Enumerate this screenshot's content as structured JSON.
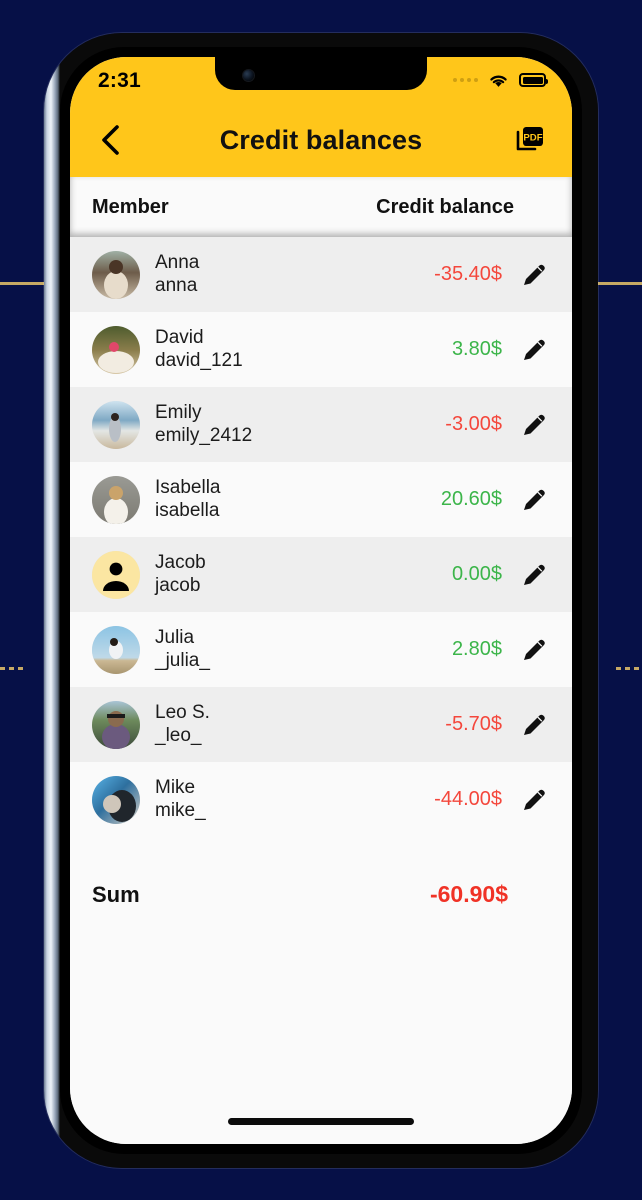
{
  "background": {
    "color": "#061047"
  },
  "status_bar": {
    "time": "2:31",
    "signal_icon": "cellular-dots-icon",
    "wifi_icon": "wifi-icon",
    "battery_icon": "battery-full-icon"
  },
  "app_bar": {
    "back_icon": "chevron-left-icon",
    "title": "Credit balances",
    "pdf_icon": "pdf-export-icon",
    "accent_color": "#FFC61A"
  },
  "table": {
    "headers": {
      "member": "Member",
      "balance": "Credit balance"
    },
    "edit_icon": "pencil-icon",
    "colors": {
      "negative": "#f4473c",
      "positive": "#3cb54a",
      "sum": "#f03226"
    },
    "rows": [
      {
        "name": "Anna",
        "username": "anna",
        "balance": "-35.40$",
        "sign": "neg",
        "avatar": "photo-anna"
      },
      {
        "name": "David",
        "username": "david_121",
        "balance": "3.80$",
        "sign": "pos",
        "avatar": "photo-david"
      },
      {
        "name": "Emily",
        "username": "emily_2412",
        "balance": "-3.00$",
        "sign": "neg",
        "avatar": "photo-emily"
      },
      {
        "name": "Isabella",
        "username": "isabella",
        "balance": "20.60$",
        "sign": "pos",
        "avatar": "photo-isabella"
      },
      {
        "name": "Jacob",
        "username": "jacob",
        "balance": "0.00$",
        "sign": "pos",
        "avatar": "person-placeholder-icon"
      },
      {
        "name": "Julia",
        "username": "_julia_",
        "balance": "2.80$",
        "sign": "pos",
        "avatar": "photo-julia"
      },
      {
        "name": "Leo S.",
        "username": "_leo_",
        "balance": "-5.70$",
        "sign": "neg",
        "avatar": "photo-leo"
      },
      {
        "name": "Mike",
        "username": "mike_",
        "balance": "-44.00$",
        "sign": "neg",
        "avatar": "photo-mike"
      }
    ]
  },
  "summary": {
    "label": "Sum",
    "value": "-60.90$"
  }
}
